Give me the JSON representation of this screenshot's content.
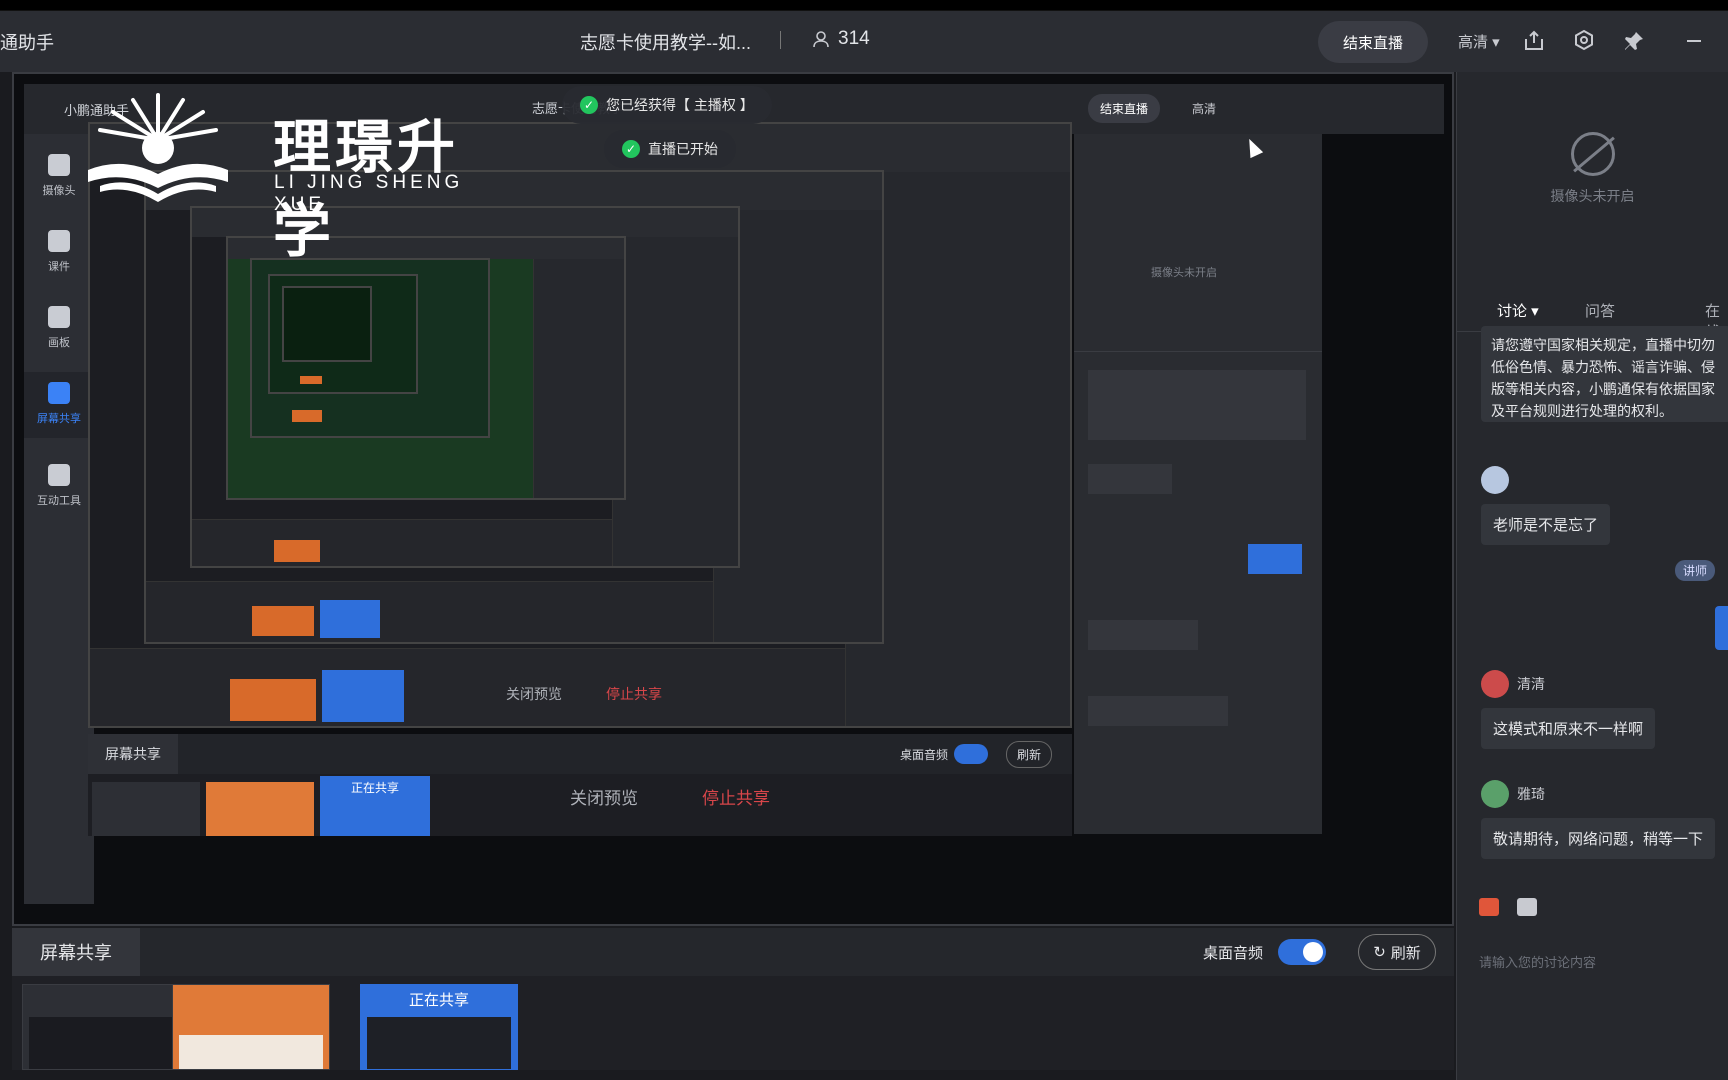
{
  "topbar": {
    "app_title": "通助手",
    "live_title": "志愿卡使用教学--如...",
    "viewer_count": "314",
    "end_live": "结束直播",
    "quality": "高清"
  },
  "watermark": {
    "cn": "理璟升学",
    "en": "LI JING SHENG XUE"
  },
  "stage": {
    "app_name": "小鹏通助手",
    "live_title": "志愿卡使用教学-",
    "end_live": "结束直播",
    "quality": "高清",
    "toast_host": "您已经获得【 主播权 】",
    "toast_started": "直播已开始",
    "tools": [
      {
        "label": "摄像头"
      },
      {
        "label": "课件"
      },
      {
        "label": "画板"
      },
      {
        "label": "屏幕共享"
      },
      {
        "label": "互动工具"
      }
    ],
    "share_tab": "屏幕共享",
    "desktop_audio": "桌面音频",
    "refresh": "刷新",
    "close_preview": "关闭预览",
    "stop_share": "停止共享",
    "sharing": "正在共享"
  },
  "share": {
    "tab": "屏幕共享",
    "desktop_audio": "桌面音频",
    "refresh": "刷新",
    "sharing": "正在共享"
  },
  "right_panel": {
    "camera_off": "摄像头未开启",
    "tabs": [
      {
        "label": "讨论"
      },
      {
        "label": "问答"
      },
      {
        "label": "在线"
      }
    ],
    "notice": "请您遵守国家相关规定，直播中切勿低俗色情、暴力恐怖、谣言诈骗、侵版等相关内容，小鹏通保有依据国家及平台规则进行处理的权利。",
    "messages": [
      {
        "user": "",
        "text": "老师是不是忘了"
      },
      {
        "user": "清清",
        "text": "这模式和原来不一样啊"
      },
      {
        "user": "雅琦",
        "text": "敬请期待，网络问题，稍等一下"
      }
    ],
    "teacher_tag": "讲师",
    "input_placeholder": "请输入您的讨论内容"
  }
}
